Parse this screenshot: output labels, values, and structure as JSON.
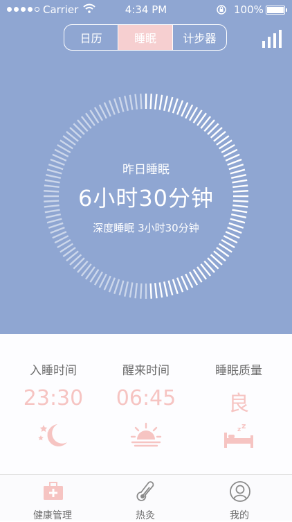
{
  "status_bar": {
    "carrier": "Carrier",
    "time": "4:34 PM",
    "battery": "100%",
    "battery_level": 1.0
  },
  "tabs": {
    "items": [
      "日历",
      "睡眠",
      "计步器"
    ],
    "active": "睡眠"
  },
  "summary": {
    "title": "昨日睡眠",
    "duration": "6小时30分钟",
    "deep_sleep": "深度睡眠 3小时30分钟"
  },
  "stats": [
    {
      "label": "入睡时间",
      "value": "23:30",
      "icon": "moon-stars-icon"
    },
    {
      "label": "醒来时间",
      "value": "06:45",
      "icon": "sunrise-icon"
    },
    {
      "label": "睡眠质量",
      "value": "良",
      "icon": "bed-zzz-icon"
    }
  ],
  "tabbar": {
    "items": [
      {
        "label": "健康管理",
        "icon": "medical-kit-icon"
      },
      {
        "label": "热灸",
        "icon": "thermometer-icon"
      },
      {
        "label": "我的",
        "icon": "user-profile-icon"
      }
    ]
  },
  "colors": {
    "hero_background": "#8fa6d2",
    "accent_pink": "#f6c4c2",
    "active_tab": "#f6cfd0",
    "label_gray": "#6c6c6c"
  }
}
